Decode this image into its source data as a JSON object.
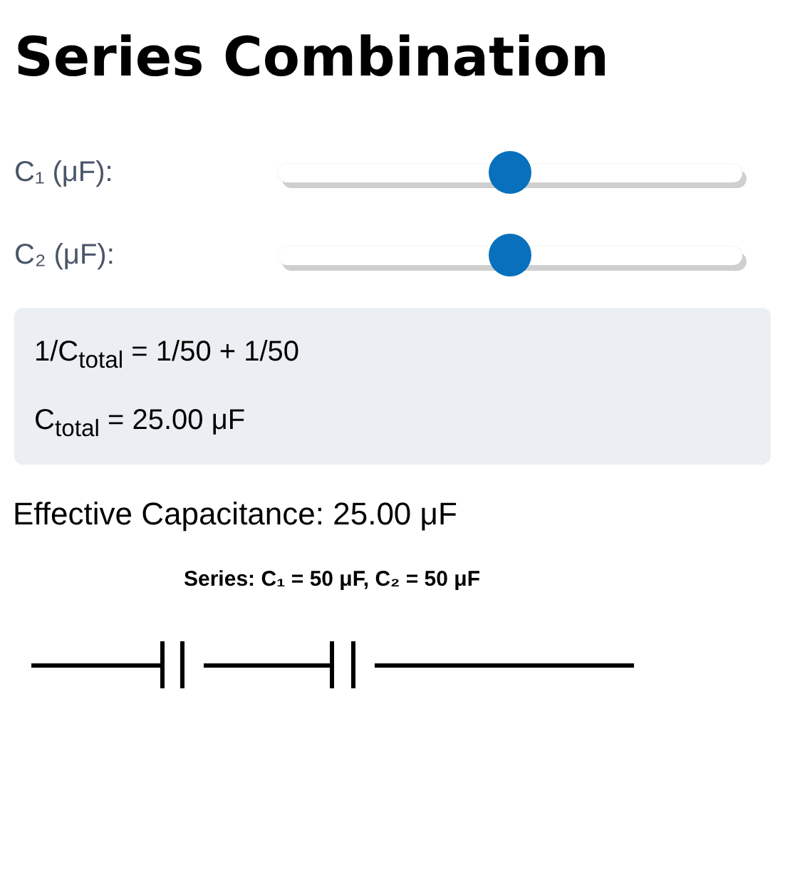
{
  "title": "Series Combination",
  "sliders": [
    {
      "label": "C₁ (μF):",
      "level": 0.5
    },
    {
      "label": "C₂ (μF):",
      "level": 0.5
    }
  ],
  "formula": [
    "1/C$_{total}$ = 1/50 + 1/50",
    "C$_{total}$ = 25.00 μF"
  ],
  "result": "Effective Capacitance: 25.00 μF",
  "diagram": {
    "caption": "Series: C₁ = 50 μF, C₂ = 50 μF"
  }
}
